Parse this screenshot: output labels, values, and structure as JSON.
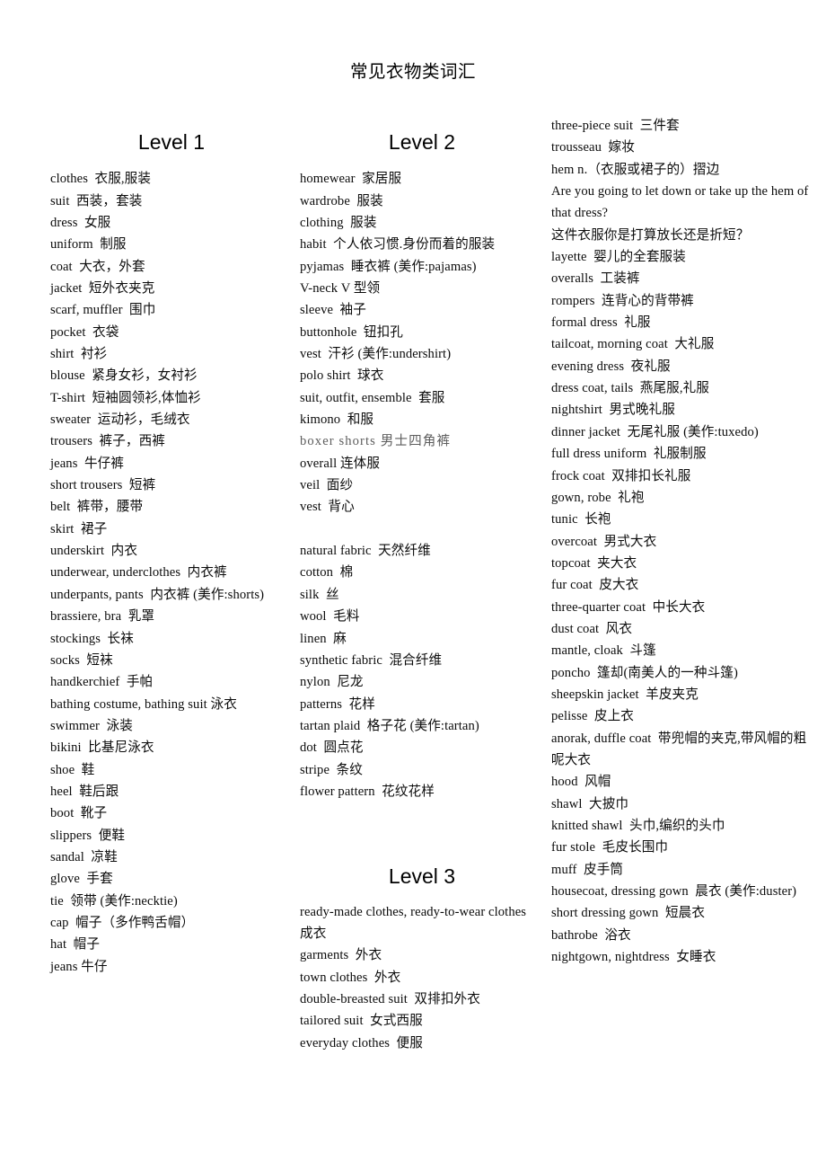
{
  "document": {
    "title": "常见衣物类词汇"
  },
  "columns": [
    {
      "id": "column-1",
      "heading": "Level 1",
      "entries": [
        "clothes  衣服,服装",
        "suit  西装，套装",
        "dress  女服",
        "uniform  制服",
        "coat  大衣，外套",
        "jacket  短外衣夹克",
        "scarf, muffler  围巾",
        "pocket  衣袋",
        "shirt  衬衫",
        "blouse  紧身女衫，女衬衫",
        "T-shirt  短袖圆领衫,体恤衫",
        "sweater  运动衫，毛绒衣",
        "trousers  裤子，西裤",
        "jeans  牛仔裤",
        "short trousers  短裤",
        "belt  裤带，腰带",
        "skirt  裙子",
        "underskirt  内衣",
        "underwear, underclothes  内衣裤",
        "underpants, pants  内衣裤 (美作:shorts)",
        "brassiere, bra  乳罩",
        "stockings  长袜",
        "socks  短袜",
        "handkerchief  手帕",
        "bathing costume, bathing suit 泳衣",
        "swimmer  泳装",
        "bikini  比基尼泳衣",
        "shoe  鞋",
        "heel  鞋后跟",
        "boot  靴子",
        "slippers  便鞋",
        "sandal  凉鞋",
        "glove  手套",
        "tie  领带 (美作:necktie)",
        "cap  帽子（多作鸭舌帽）",
        "hat  帽子",
        "jeans 牛仔"
      ]
    },
    {
      "id": "column-2",
      "heading": "Level 2",
      "heading2": "Level 3",
      "entries": [
        "homewear  家居服",
        "wardrobe  服装",
        "clothing  服装",
        "habit  个人依习惯.身份而着的服装",
        "pyjamas  睡衣裤 (美作:pajamas)",
        "V-neck V 型领",
        "sleeve  袖子",
        "buttonhole  钮扣孔",
        "vest  汗衫 (美作:undershirt)",
        "polo shirt  球衣",
        "suit, outfit, ensemble  套服",
        "kimono  和服",
        "boxer shorts 男士四角裤",
        "overall 连体服",
        "veil  面纱",
        "vest  背心"
      ],
      "faint_entry_index": 12,
      "entries_group2": [
        "natural fabric  天然纤维",
        "cotton  棉",
        "silk  丝",
        "wool  毛料",
        "linen  麻",
        "synthetic fabric  混合纤维",
        "nylon  尼龙",
        "patterns  花样",
        "tartan plaid  格子花 (美作:tartan)",
        "dot  圆点花",
        "stripe  条纹",
        "flower pattern  花纹花样"
      ],
      "entries_level3": [
        "ready-made clothes, ready-to-wear clothes  成衣",
        "garments  外衣",
        "town clothes  外衣",
        "double-breasted suit  双排扣外衣",
        "tailored suit  女式西服",
        "everyday clothes  便服"
      ]
    },
    {
      "id": "column-3",
      "heading": "",
      "entries": [
        "three-piece suit  三件套",
        "trousseau  嫁妆",
        "hem n.（衣服或裙子的）摺边",
        "Are you going to let down or take up the hem of that dress?",
        "这件衣服你是打算放长还是折短？",
        "layette  婴儿的全套服装",
        "overalls  工装裤",
        "rompers  连背心的背带裤",
        "formal dress  礼服",
        "tailcoat, morning coat  大礼服",
        "evening dress  夜礼服",
        "dress coat, tails  燕尾服,礼服",
        "nightshirt  男式晚礼服",
        "dinner jacket  无尾礼服 (美作:tuxedo)",
        "full dress uniform  礼服制服",
        "frock coat  双排扣长礼服",
        "gown, robe  礼袍",
        "tunic  长袍",
        "overcoat  男式大衣",
        "topcoat  夹大衣",
        "fur coat  皮大衣",
        "three-quarter coat  中长大衣",
        "dust coat  风衣",
        "mantle, cloak  斗篷",
        "poncho  篷却(南美人的一种斗篷)",
        "sheepskin jacket  羊皮夹克",
        "pelisse  皮上衣",
        "anorak, duffle coat  带兜帽的夹克,带风帽的粗呢大衣",
        "hood  风帽",
        "shawl  大披巾",
        "knitted shawl  头巾,编织的头巾",
        "fur stole  毛皮长围巾",
        "muff  皮手筒",
        "housecoat, dressing gown  晨衣 (美作:duster)",
        "short dressing gown  短晨衣",
        "bathrobe  浴衣",
        "nightgown, nightdress  女睡衣"
      ]
    }
  ],
  "colors": {
    "text": "#0b0b0b",
    "faint_text": "#5d5d5d",
    "background": "#ffffff"
  }
}
